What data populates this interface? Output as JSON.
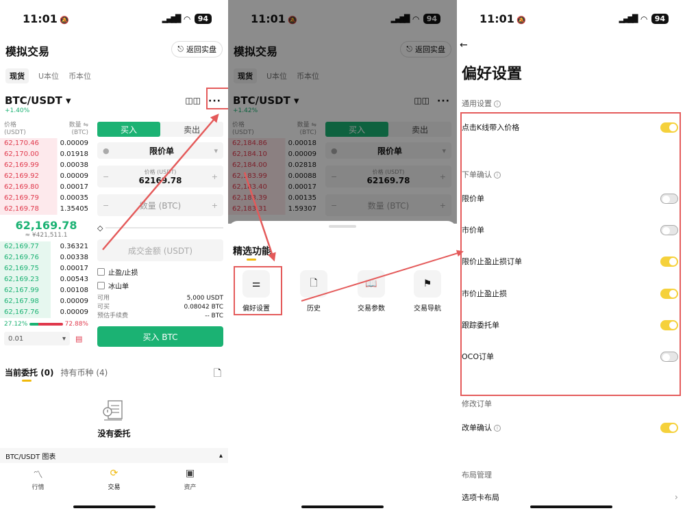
{
  "status": {
    "time": "11:01",
    "battery": "94"
  },
  "panel1": {
    "title": "模拟交易",
    "back_real": "返回实盘",
    "market_tabs": [
      "现货",
      "U本位",
      "币本位"
    ],
    "pair": "BTC/USDT ▾",
    "change": "+1.40%",
    "candle_icon": "candle-chart-icon",
    "more": "···",
    "ob_head": {
      "price": "价格",
      "price_unit": "(USDT)",
      "amount": "数量 ⇋",
      "amount_unit": "(BTC)"
    },
    "asks": [
      {
        "p": "62,170.46",
        "a": "0.00009"
      },
      {
        "p": "62,170.00",
        "a": "0.01918"
      },
      {
        "p": "62,169.99",
        "a": "0.00038"
      },
      {
        "p": "62,169.92",
        "a": "0.00009"
      },
      {
        "p": "62,169.80",
        "a": "0.00017"
      },
      {
        "p": "62,169.79",
        "a": "0.00035"
      },
      {
        "p": "62,169.78",
        "a": "1.35405"
      }
    ],
    "mid": "62,169.78",
    "fiat": "≈ ¥421,511.1",
    "bids": [
      {
        "p": "62,169.77",
        "a": "0.36321"
      },
      {
        "p": "62,169.76",
        "a": "0.00338"
      },
      {
        "p": "62,169.75",
        "a": "0.00017"
      },
      {
        "p": "62,169.23",
        "a": "0.00543"
      },
      {
        "p": "62,167.99",
        "a": "0.00108"
      },
      {
        "p": "62,167.98",
        "a": "0.00009"
      },
      {
        "p": "62,167.76",
        "a": "0.00009"
      }
    ],
    "ratio_buy": "27.12%",
    "ratio_sell": "72.88%",
    "precision": "0.01",
    "buy_tab": "买入",
    "sell_tab": "卖出",
    "order_type": "限价单",
    "price_label": "价格 (USDT)",
    "price_value": "62169.78",
    "qty_ph": "数量 (BTC)",
    "total_ph": "成交金额 (USDT)",
    "tpsl": "止盈/止损",
    "iceberg": "冰山单",
    "avail_label": "可用",
    "avail_value": "5,000 USDT",
    "canbuy_label": "可买",
    "canbuy_value": "0.08042 BTC",
    "fee_label": "预估手续费",
    "fee_value": "-- BTC",
    "buy_btn": "买入 BTC",
    "orders_tab": "当前委托 (0)",
    "holdings_tab": "持有币种 (4)",
    "empty": "没有委托",
    "chart_bar": "BTC/USDT 图表",
    "nav": [
      {
        "label": "行情",
        "icon": "market-icon"
      },
      {
        "label": "交易",
        "icon": "trade-icon"
      },
      {
        "label": "资产",
        "icon": "wallet-icon"
      }
    ]
  },
  "panel2": {
    "title": "模拟交易",
    "back_real": "返回实盘",
    "market_tabs": [
      "现货",
      "U本位",
      "币本位"
    ],
    "pair": "BTC/USDT ▾",
    "change": "+1.42%",
    "asks": [
      {
        "p": "62,184.86",
        "a": "0.00018"
      },
      {
        "p": "62,184.10",
        "a": "0.00009"
      },
      {
        "p": "62,184.00",
        "a": "0.02818"
      },
      {
        "p": "62,183.99",
        "a": "0.00088"
      },
      {
        "p": "62,183.40",
        "a": "0.00017"
      },
      {
        "p": "62,183.39",
        "a": "0.00135"
      },
      {
        "p": "62,183.31",
        "a": "1.59307"
      }
    ],
    "buy_tab": "买入",
    "sell_tab": "卖出",
    "order_type": "限价单",
    "price_label": "价格 (USDT)",
    "price_value": "62169.78",
    "qty_ph": "数量 (BTC)",
    "sheet_title": "精选功能",
    "features": [
      {
        "label": "偏好设置",
        "icon": "sliders-icon"
      },
      {
        "label": "历史",
        "icon": "history-icon"
      },
      {
        "label": "交易参数",
        "icon": "book-icon"
      },
      {
        "label": "交易导航",
        "icon": "signpost-icon"
      }
    ]
  },
  "panel3": {
    "title": "偏好设置",
    "general": "通用设置",
    "kline_price": "点击K线带入价格",
    "order_confirm": "下单确认",
    "limit": "限价单",
    "market": "市价单",
    "limit_tpsl": "限价止盈止损订单",
    "market_tpsl": "市价止盈止损",
    "trailing": "跟踪委托单",
    "oco": "OCO订单",
    "modify": "修改订单",
    "modify_confirm": "改单确认",
    "layout": "布局管理",
    "tab_layout": "选项卡布局"
  },
  "colors": {
    "green": "#1bb273",
    "red": "#e0394c",
    "yellow": "#f5d13b",
    "highlight": "#e45a5a"
  }
}
